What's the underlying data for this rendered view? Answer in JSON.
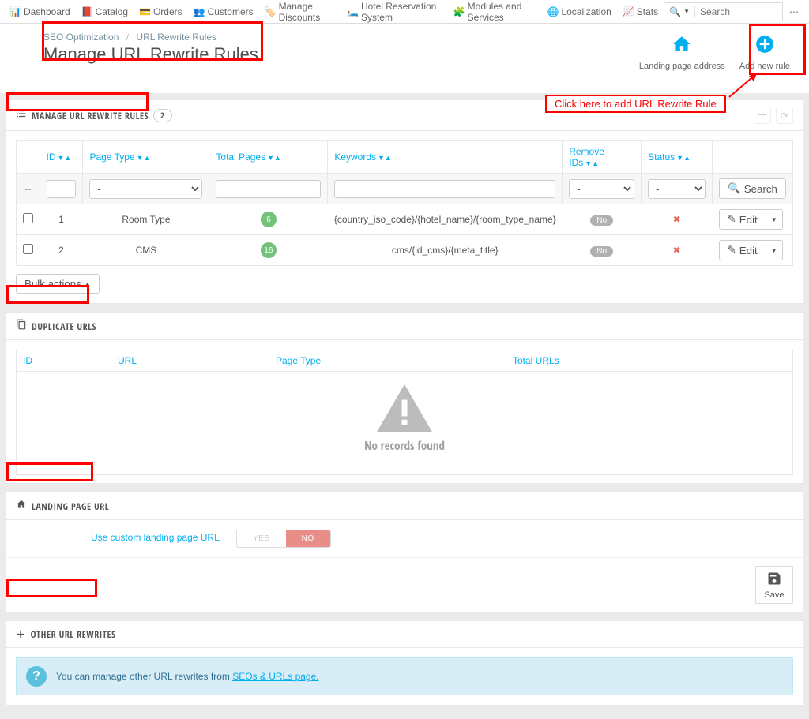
{
  "nav": {
    "items": [
      {
        "label": "Dashboard",
        "icon": "dashboard"
      },
      {
        "label": "Catalog",
        "icon": "book"
      },
      {
        "label": "Orders",
        "icon": "credit-card"
      },
      {
        "label": "Customers",
        "icon": "users"
      },
      {
        "label": "Manage Discounts",
        "icon": "tags"
      },
      {
        "label": "Hotel Reservation System",
        "icon": "bed"
      },
      {
        "label": "Modules and Services",
        "icon": "puzzle"
      },
      {
        "label": "Localization",
        "icon": "globe"
      },
      {
        "label": "Stats",
        "icon": "bar-chart"
      }
    ],
    "search_placeholder": "Search"
  },
  "breadcrumb": {
    "parent": "SEO Optimization",
    "current": "URL Rewrite Rules"
  },
  "title": "Manage URL Rewrite Rules",
  "header_actions": {
    "landing": "Landing page address",
    "add": "Add new rule"
  },
  "annotation": {
    "callout": "Click here to add URL Rewrite Rule"
  },
  "panel1": {
    "title": "Manage URL Rewrite Rules",
    "count": "2",
    "columns": {
      "id": "ID",
      "page_type": "Page Type",
      "total_pages": "Total Pages",
      "keywords": "Keywords",
      "remove_ids": "Remove IDs",
      "status": "Status"
    },
    "search_btn": "Search",
    "filter_dash": "-",
    "rows": [
      {
        "id": "1",
        "page_type": "Room Type",
        "total_pages": "6",
        "keywords": "{country_iso_code}/{hotel_name}/{room_type_name}",
        "remove_ids": "No",
        "edit": "Edit"
      },
      {
        "id": "2",
        "page_type": "CMS",
        "total_pages": "16",
        "keywords": "cms/{id_cms}/{meta_title}",
        "remove_ids": "No",
        "edit": "Edit"
      }
    ],
    "bulk": "Bulk actions"
  },
  "panel2": {
    "title": "Duplicate URLs",
    "columns": {
      "id": "ID",
      "url": "URL",
      "page_type": "Page Type",
      "total_urls": "Total URLs"
    },
    "empty": "No records found"
  },
  "panel3": {
    "title": "Landing page URL",
    "label": "Use custom landing page URL",
    "yes": "YES",
    "no": "NO",
    "save": "Save"
  },
  "panel4": {
    "title": "Other URL Rewrites",
    "alert_pre": "You can manage other URL rewrites from ",
    "alert_link": "SEOs & URLs page."
  }
}
